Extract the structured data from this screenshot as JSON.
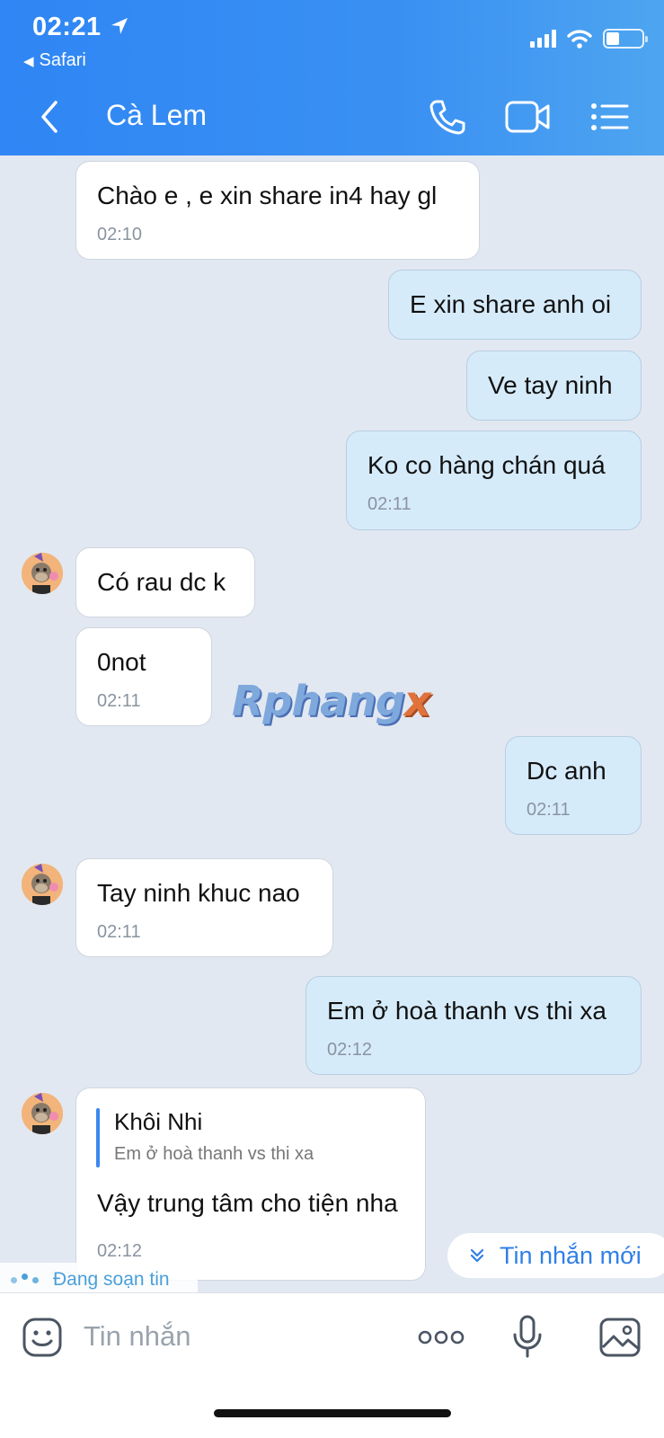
{
  "status_bar": {
    "time": "02:21",
    "back_app": "Safari"
  },
  "header": {
    "title": "Cà Lem",
    "icons": [
      "back-chevron-icon",
      "phone-icon",
      "video-call-icon",
      "menu-list-icon"
    ]
  },
  "messages": [
    {
      "side": "in",
      "text": "Chào e , e xin share in4 hay gl",
      "time": "02:10"
    },
    {
      "side": "out",
      "text": "E xin share anh oi",
      "time": ""
    },
    {
      "side": "out",
      "text": "Ve tay ninh",
      "time": ""
    },
    {
      "side": "out",
      "text": "Ko co hàng chán quá",
      "time": "02:11"
    },
    {
      "side": "in",
      "text": "Có rau dc k",
      "time": ""
    },
    {
      "side": "in",
      "text": "0not",
      "time": "02:11"
    },
    {
      "side": "out",
      "text": "Dc anh",
      "time": "02:11"
    },
    {
      "side": "in",
      "text": "Tay ninh khuc nao",
      "time": "02:11"
    },
    {
      "side": "out",
      "text": "Em ở hoà thanh vs thi xa",
      "time": "02:12"
    },
    {
      "side": "in",
      "text": "Vậy trung tâm cho tiện nha",
      "time": "02:12",
      "reply": {
        "name": "Khôi Nhi",
        "text": "Em ở hoà thanh vs thi xa"
      }
    }
  ],
  "watermark": {
    "main": "Rphang",
    "accent": "x"
  },
  "new_message_button": "Tin nhắn mới",
  "typing_indicator": "Đang soạn tin",
  "composer": {
    "placeholder": "Tin nhắn",
    "icons": [
      "sticker-icon",
      "more-icon",
      "microphone-icon",
      "image-icon"
    ]
  },
  "colors": {
    "header": "#2f86f4",
    "incoming_bubble": "#ffffff",
    "outgoing_bubble": "#d6ebfa",
    "background": "#e2e8f1",
    "accent": "#2f7fe6"
  }
}
